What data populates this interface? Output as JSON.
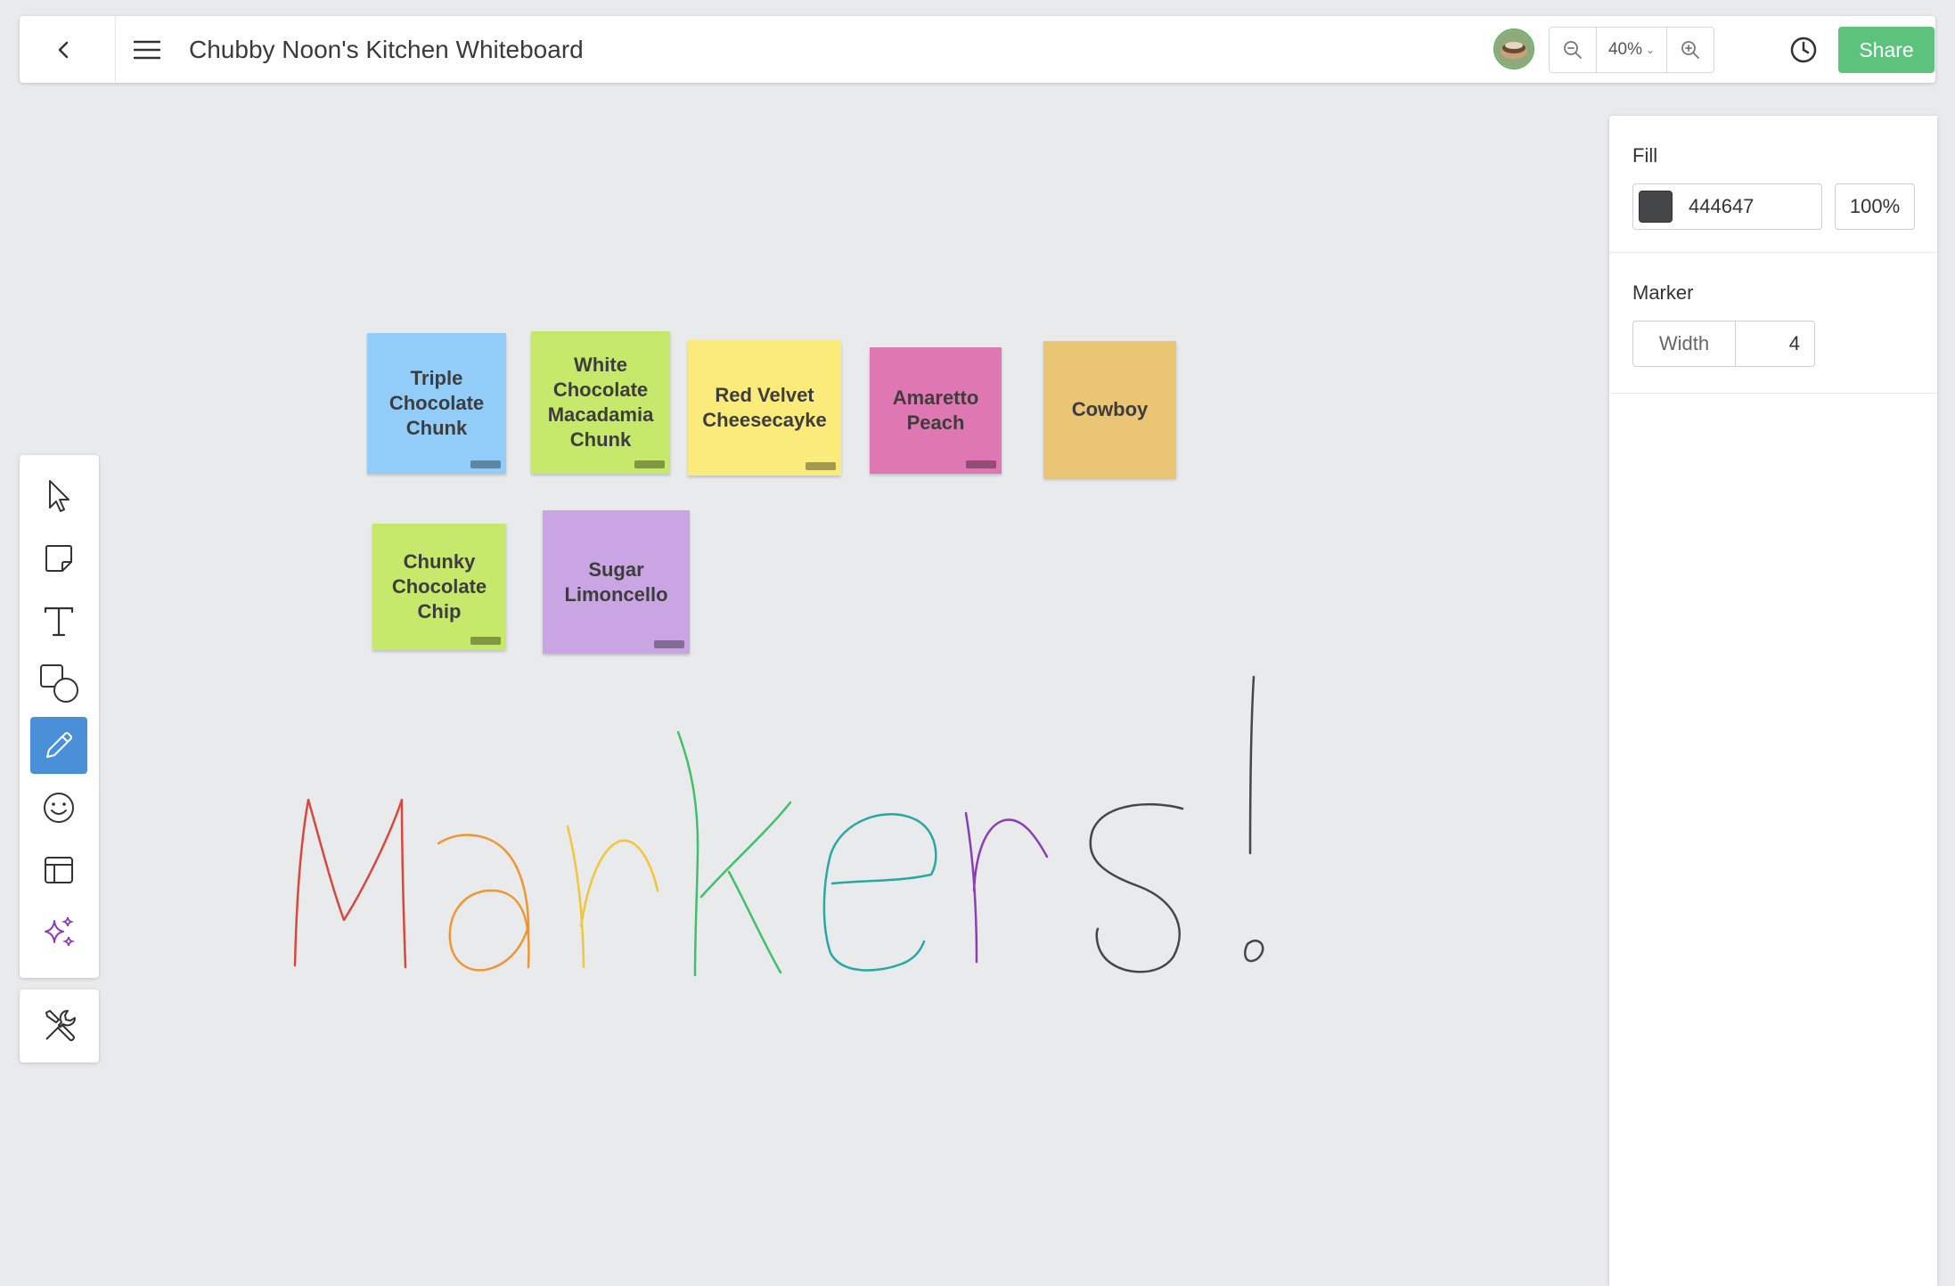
{
  "header": {
    "title": "Chubby Noon's Kitchen Whiteboard",
    "zoom_level": "40%",
    "share_label": "Share"
  },
  "panel": {
    "fill_label": "Fill",
    "fill_hex": "444647",
    "fill_color": "#444647",
    "fill_opacity": "100%",
    "marker_label": "Marker",
    "width_label": "Width",
    "width_value": "4"
  },
  "toolbar": {
    "tools": [
      "select-icon",
      "sticky-note-icon",
      "text-icon",
      "shapes-icon",
      "pencil-icon",
      "emoji-icon",
      "template-icon",
      "sparkle-icon"
    ],
    "active_tool": "pencil-icon",
    "extra_tool": "tools-icon"
  },
  "stickies": [
    {
      "text": "Triple Chocolate Chunk",
      "color": "#91cdf8"
    },
    {
      "text": "White Chocolate Macadamia Chunk",
      "color": "#c7e96b"
    },
    {
      "text": "Red Velvet Cheesecayke",
      "color": "#fbeb7b"
    },
    {
      "text": "Amaretto Peach",
      "color": "#df78b2"
    },
    {
      "text": "Cowboy",
      "color": "#eac574"
    },
    {
      "text": "Chunky Chocolate Chip",
      "color": "#c7e96b"
    },
    {
      "text": "Sugar Limoncello",
      "color": "#c9a6e3"
    }
  ],
  "accent_colors": {
    "share": "#5cc27c",
    "active_tool": "#4a90d9"
  }
}
